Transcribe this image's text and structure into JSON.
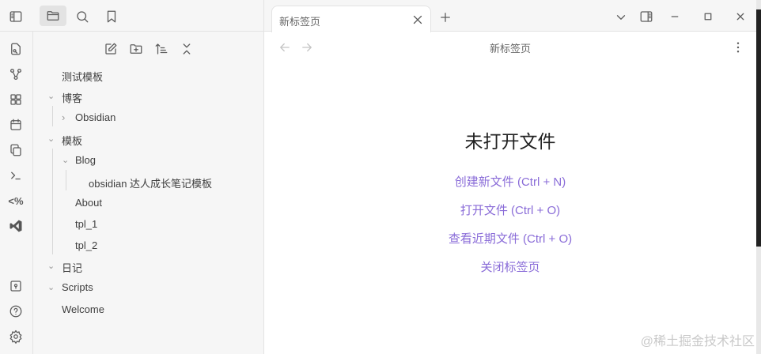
{
  "sidebar_tabs": {
    "toggle": "sidebar-toggle-icon",
    "files": "folder-icon",
    "search": "search-icon",
    "bookmarks": "bookmark-icon"
  },
  "explorer_actions": [
    "new-note",
    "new-folder",
    "sort",
    "collapse-all"
  ],
  "tree": [
    {
      "label": "测试模板"
    },
    {
      "label": "博客",
      "expanded": true
    },
    {
      "label": "Obsidian",
      "expanded": false
    },
    {
      "label": "模板",
      "expanded": true
    },
    {
      "label": "Blog",
      "expanded": true
    },
    {
      "label": "obsidian 达人成长笔记模板"
    },
    {
      "label": "About"
    },
    {
      "label": "tpl_1"
    },
    {
      "label": "tpl_2"
    },
    {
      "label": "日记",
      "expanded": true
    },
    {
      "label": "Scripts",
      "expanded": true
    },
    {
      "label": "Welcome"
    }
  ],
  "tab": {
    "title": "新标签页"
  },
  "nav_title": "新标签页",
  "empty": {
    "title": "未打开文件",
    "actions": [
      "创建新文件 (Ctrl + N)",
      "打开文件 (Ctrl + O)",
      "查看近期文件 (Ctrl + O)",
      "关闭标签页"
    ]
  },
  "ribbon_extra": {
    "templater": "<%"
  },
  "watermark": "@稀土掘金技术社区",
  "accent": "#8a6cd8"
}
